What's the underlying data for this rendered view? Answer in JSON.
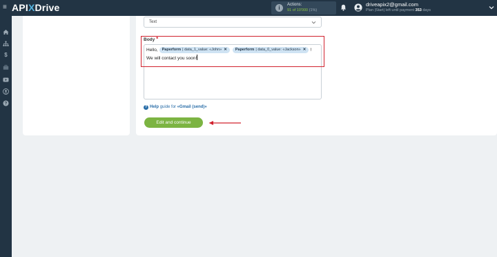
{
  "header": {
    "logo_api": "API",
    "logo_x": "X",
    "logo_drive": "Drive",
    "actions_label": "Actions:",
    "actions_count": "91 of 10'000",
    "actions_pct": "(1%)",
    "email": "driveapix2@gmail.com",
    "plan_prefix": "Plan |Start| left until payment",
    "plan_days": "353",
    "plan_suffix": "days"
  },
  "sidebar": {
    "icons": [
      "home-icon",
      "sitemap-icon",
      "dollar-icon",
      "briefcase-icon",
      "video-icon",
      "user-icon",
      "help-icon"
    ]
  },
  "form": {
    "select_value": "Text",
    "body_label": "Body",
    "required_mark": "*",
    "line1_prefix": "Hello,",
    "chips": [
      {
        "source": "Paperform",
        "field": "| data_1_value: «John»"
      },
      {
        "source": "Paperform",
        "field": "| data_0_value: «Jackson»"
      }
    ],
    "line1_suffix": "!",
    "line2": "We will contact you soon!",
    "help_label": "Help",
    "help_text": "guide for",
    "help_link": "«Gmail (send)»",
    "button_label": "Edit and continue"
  },
  "colors": {
    "topbar": "#223444",
    "accent_green": "#7cb442",
    "highlight_red": "#d0202c",
    "chip_bg": "#cfe3f3",
    "link_blue": "#2a6ea8"
  }
}
